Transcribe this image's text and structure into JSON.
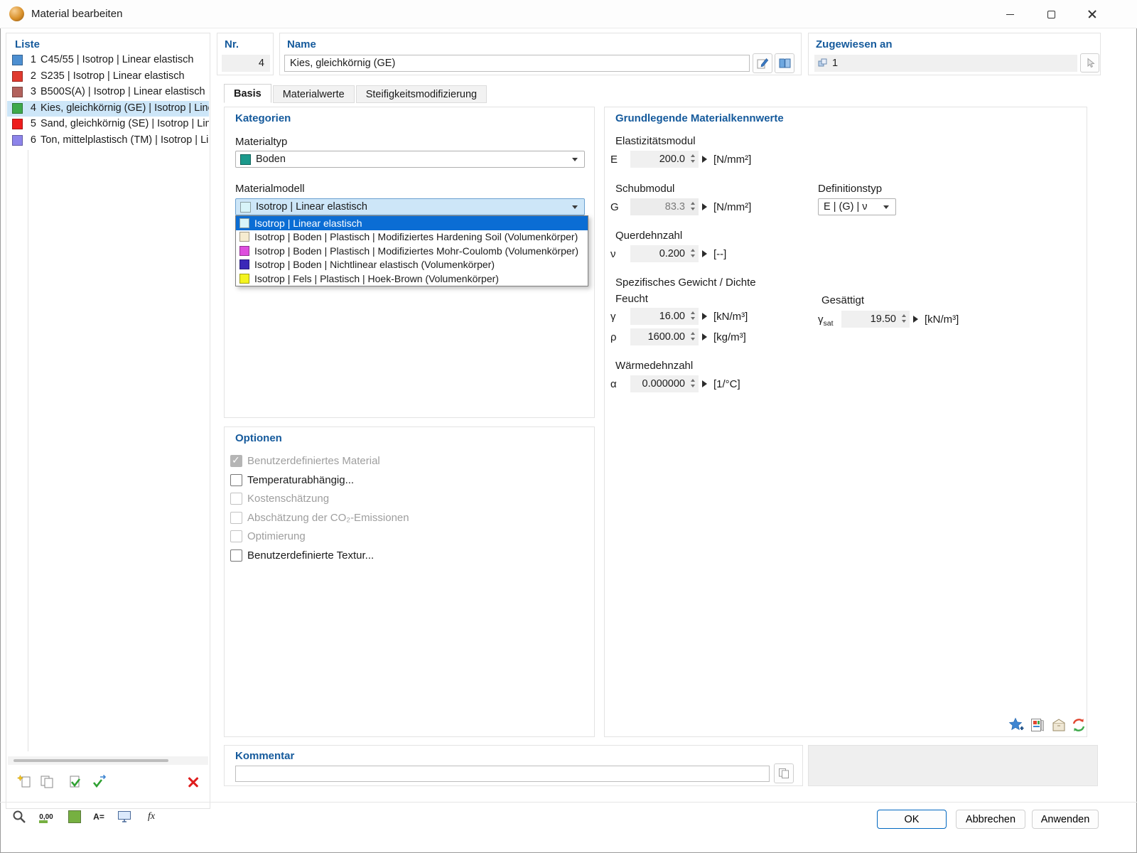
{
  "window": {
    "title": "Material bearbeiten"
  },
  "list": {
    "heading": "Liste",
    "items": [
      {
        "num": "1",
        "label": "C45/55 | Isotrop | Linear elastisch",
        "color": "#4d8fd1",
        "selected": false
      },
      {
        "num": "2",
        "label": "S235 | Isotrop | Linear elastisch",
        "color": "#e03a2f",
        "selected": false
      },
      {
        "num": "3",
        "label": "B500S(A) | Isotrop | Linear elastisch",
        "color": "#b2625d",
        "selected": false
      },
      {
        "num": "4",
        "label": "Kies, gleichkörnig (GE) | Isotrop | Linear el",
        "color": "#3ea94b",
        "selected": true
      },
      {
        "num": "5",
        "label": "Sand, gleichkörnig (SE) | Isotrop | Linear e",
        "color": "#ee1d1d",
        "selected": false
      },
      {
        "num": "6",
        "label": "Ton, mittelplastisch (TM) | Isotrop | Linear",
        "color": "#8d84ea",
        "selected": false
      }
    ]
  },
  "header": {
    "nr": {
      "label": "Nr.",
      "value": "4"
    },
    "name": {
      "label": "Name",
      "value": "Kies, gleichkörnig (GE)"
    },
    "assigned": {
      "label": "Zugewiesen an",
      "value": "1"
    }
  },
  "tabs": [
    {
      "label": "Basis",
      "active": true
    },
    {
      "label": "Materialwerte",
      "active": false
    },
    {
      "label": "Steifigkeitsmodifizierung",
      "active": false
    }
  ],
  "kategorien": {
    "heading": "Kategorien",
    "materialtyp": {
      "label": "Materialtyp",
      "value": "Boden",
      "color": "#1b998b"
    },
    "materialmodell": {
      "label": "Materialmodell",
      "value": "Isotrop | Linear elastisch",
      "color": "#d8f4f9"
    },
    "dropdown_options": [
      {
        "label": "Isotrop | Linear elastisch",
        "color": "#d8f4f9",
        "selected": true
      },
      {
        "label": "Isotrop | Boden | Plastisch | Modifiziertes Hardening Soil (Volumenkörper)",
        "color": "#f6ecd0",
        "selected": false
      },
      {
        "label": "Isotrop | Boden | Plastisch | Modifiziertes Mohr-Coulomb (Volumenkörper)",
        "color": "#de4ede",
        "selected": false
      },
      {
        "label": "Isotrop | Boden | Nichtlinear elastisch (Volumenkörper)",
        "color": "#3b28b8",
        "selected": false
      },
      {
        "label": "Isotrop | Fels | Plastisch | Hoek-Brown (Volumenkörper)",
        "color": "#f4f41f",
        "selected": false
      }
    ]
  },
  "optionen": {
    "heading": "Optionen",
    "items": [
      {
        "label": "Benutzerdefiniertes Material",
        "checked": true,
        "enabled": false
      },
      {
        "label": "Temperaturabhängig...",
        "checked": false,
        "enabled": true
      },
      {
        "label": "Kostenschätzung",
        "checked": false,
        "enabled": false
      },
      {
        "label": "Abschätzung der CO₂-Emissionen",
        "checked": false,
        "enabled": false
      },
      {
        "label": "Optimierung",
        "checked": false,
        "enabled": false
      },
      {
        "label": "Benutzerdefinierte Textur...",
        "checked": false,
        "enabled": true
      }
    ]
  },
  "kennwerte": {
    "heading": "Grundlegende Materialkennwerte",
    "elastizitaet": {
      "label": "Elastizitätsmodul",
      "symbol": "E",
      "value": "200.0",
      "unit": "[N/mm²]"
    },
    "schub": {
      "label": "Schubmodul",
      "symbol": "G",
      "value": "83.3",
      "unit": "[N/mm²]"
    },
    "definitionstyp": {
      "label": "Definitionstyp",
      "value": "E | (G) | ν"
    },
    "querdehn": {
      "label": "Querdehnzahl",
      "symbol": "ν",
      "value": "0.200",
      "unit": "[--]"
    },
    "gewicht_label": "Spezifisches Gewicht / Dichte",
    "feucht_label": "Feucht",
    "gesaettigt_label": "Gesättigt",
    "gamma": {
      "symbol": "γ",
      "value": "16.00",
      "unit": "[kN/m³]"
    },
    "rho": {
      "symbol": "ρ",
      "value": "1600.00",
      "unit": "[kg/m³]"
    },
    "gamma_sat": {
      "symbol": "γ",
      "sub": "sat",
      "value": "19.50",
      "unit": "[kN/m³]"
    },
    "waerme": {
      "label": "Wärmedehnzahl",
      "symbol": "α",
      "value": "0.000000",
      "unit": "[1/°C]"
    }
  },
  "kommentar": {
    "heading": "Kommentar",
    "value": ""
  },
  "footer": {
    "ok": "OK",
    "cancel": "Abbrechen",
    "apply": "Anwenden",
    "decimal_glyph": "0,00",
    "units_glyph": "A=",
    "formula_glyph": "fx",
    "swatch_color": "#76b041"
  }
}
